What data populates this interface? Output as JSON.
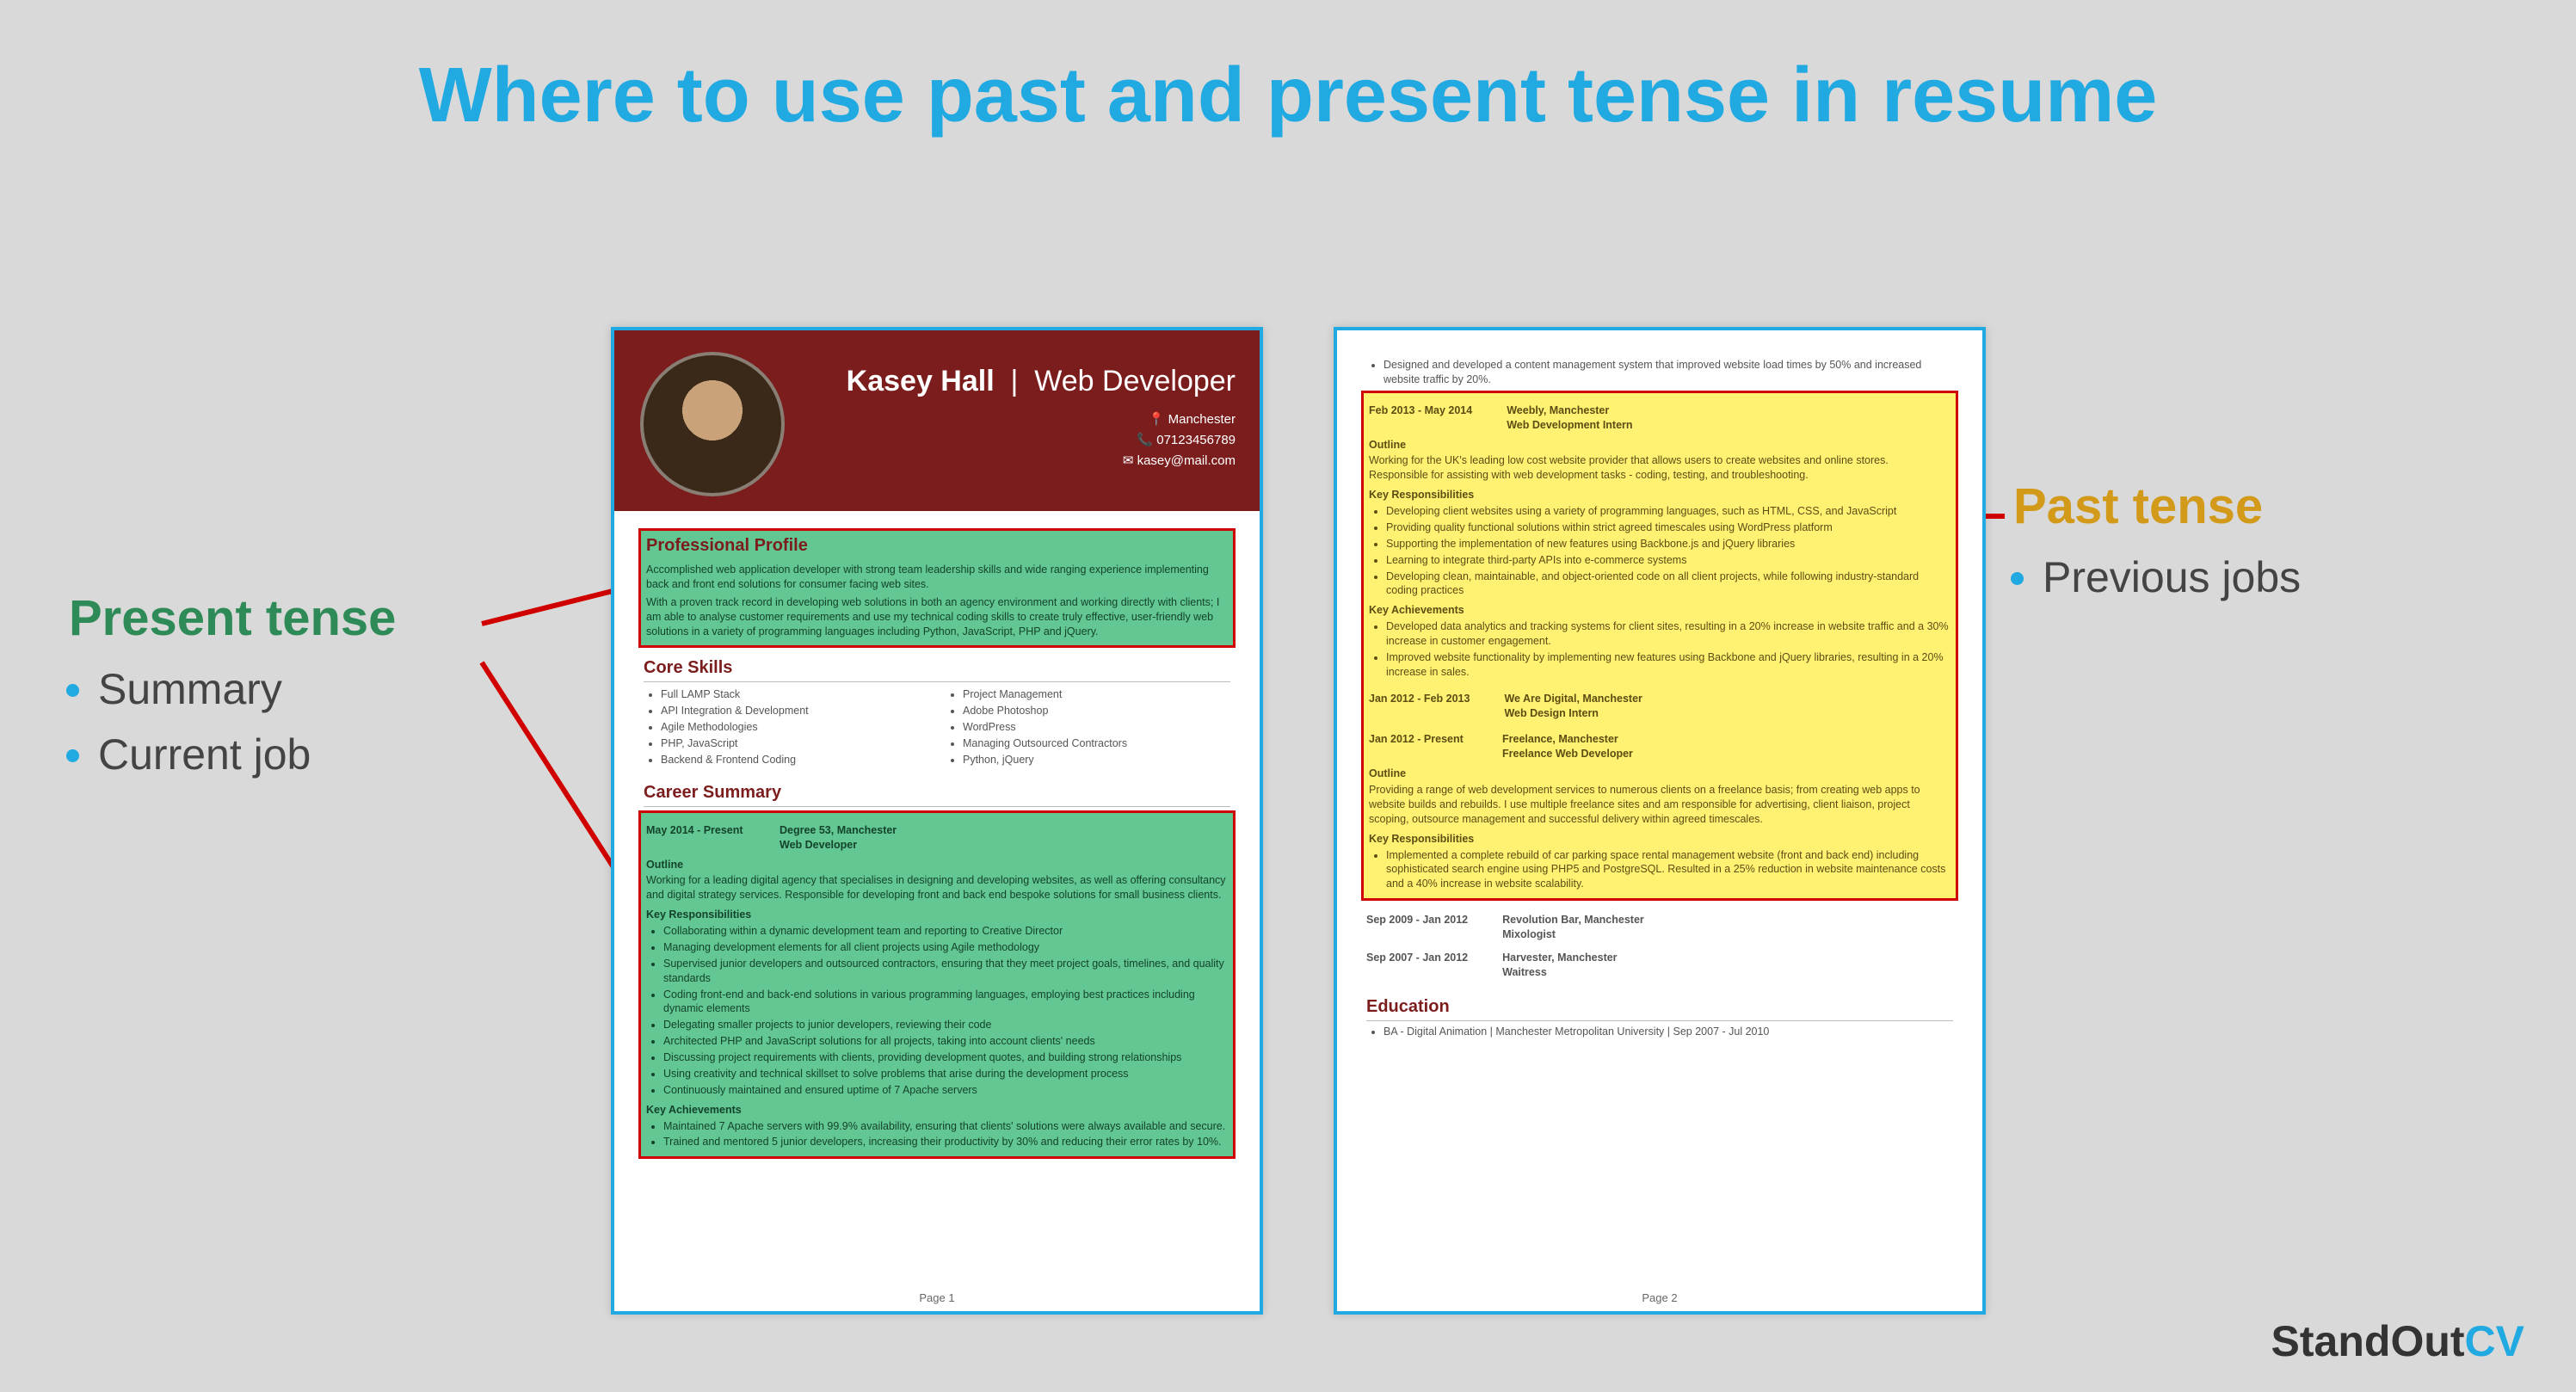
{
  "title": "Where to use past and present tense in resume",
  "annotations": {
    "present": {
      "heading": "Present tense",
      "items": [
        "Summary",
        "Current job"
      ]
    },
    "past": {
      "heading": "Past tense",
      "items": [
        "Previous jobs"
      ]
    }
  },
  "brand": {
    "name": "StandOut",
    "suffix": "CV"
  },
  "resume": {
    "name": "Kasey Hall",
    "role": "Web Developer",
    "contacts": {
      "location": "Manchester",
      "phone": "07123456789",
      "email": "kasey@mail.com"
    },
    "sections": {
      "profile_title": "Professional Profile",
      "profile_p1": "Accomplished web application developer with strong team leadership skills and wide ranging experience implementing back and front end solutions for consumer facing web sites.",
      "profile_p2": "With a proven track record in developing web solutions in both an agency environment and working directly with clients; I am able to analyse customer requirements and use my technical coding skills to create truly effective, user-friendly web solutions in a variety of programming languages including Python, JavaScript, PHP and jQuery.",
      "skills_title": "Core Skills",
      "skills_left": [
        "Full LAMP Stack",
        "API Integration & Development",
        "Agile Methodologies",
        "PHP, JavaScript",
        "Backend & Frontend Coding"
      ],
      "skills_right": [
        "Project Management",
        "Adobe Photoshop",
        "WordPress",
        "Managing Outsourced Contractors",
        "Python, jQuery"
      ],
      "career_title": "Career Summary",
      "job1": {
        "dates": "May 2014 - Present",
        "company": "Degree 53, Manchester",
        "title": "Web Developer",
        "outline_label": "Outline",
        "outline": "Working for a leading digital agency that specialises in designing and developing websites, as well as offering consultancy and digital strategy services. Responsible for developing front and back end bespoke solutions for small business clients.",
        "resp_label": "Key Responsibilities",
        "resp": [
          "Collaborating within a dynamic development team and reporting to Creative Director",
          "Managing development elements for all client projects using Agile methodology",
          "Supervised junior developers and outsourced contractors, ensuring that they meet project goals, timelines, and quality standards",
          "Coding front-end and back-end solutions in various programming languages, employing best practices including dynamic elements",
          "Delegating smaller projects to junior developers, reviewing their code",
          "Architected PHP and JavaScript solutions for all projects, taking into account clients' needs",
          "Discussing project requirements with clients, providing development quotes, and building strong relationships",
          "Using creativity and technical skillset to solve problems that arise during the development process",
          "Continuously maintained and ensured uptime of 7 Apache servers"
        ],
        "ach_label": "Key Achievements",
        "ach": [
          "Maintained 7 Apache servers with 99.9% availability, ensuring that clients' solutions were always available and secure.",
          "Trained and mentored 5 junior developers, increasing their productivity by 30% and reducing their error rates by 10%."
        ]
      },
      "page2_top_bullet": "Designed and developed a content management system that improved website load times by 50% and increased website traffic by 20%.",
      "job2": {
        "dates": "Feb 2013 - May 2014",
        "company": "Weebly, Manchester",
        "title": "Web Development Intern",
        "outline_label": "Outline",
        "outline": "Working for the UK's leading low cost website provider that allows users to create websites and online stores. Responsible for assisting with web development tasks - coding, testing, and troubleshooting.",
        "resp_label": "Key Responsibilities",
        "resp": [
          "Developing client websites using a variety of programming languages, such as HTML, CSS, and JavaScript",
          "Providing quality functional solutions within strict agreed timescales using WordPress platform",
          "Supporting the implementation of new features using Backbone.js and jQuery libraries",
          "Learning to integrate third-party APIs into e-commerce systems",
          "Developing clean, maintainable, and object-oriented code on all client projects, while following industry-standard coding practices"
        ],
        "ach_label": "Key Achievements",
        "ach": [
          "Developed data analytics and tracking systems for client sites, resulting in a 20% increase in website traffic and a 30% increase in customer engagement.",
          "Improved website functionality by implementing new features using Backbone and jQuery libraries, resulting in a 20% increase in sales."
        ]
      },
      "job3": {
        "dates": "Jan 2012 - Feb 2013",
        "company": "We Are Digital, Manchester",
        "title": "Web Design Intern"
      },
      "job4": {
        "dates": "Jan 2012 - Present",
        "company": "Freelance, Manchester",
        "title": "Freelance Web Developer",
        "outline_label": "Outline",
        "outline": "Providing a range of web development services to numerous clients on a freelance basis; from creating web apps to website builds and rebuilds. I use multiple freelance sites and am responsible for advertising, client liaison, project scoping, outsource management and successful delivery within agreed timescales.",
        "resp_label": "Key Responsibilities",
        "resp": [
          "Implemented a complete rebuild of car parking space rental management website (front and back end) including sophisticated search engine using PHP5 and PostgreSQL. Resulted in a 25% reduction in website maintenance costs and a 40% increase in website scalability."
        ]
      },
      "job5": {
        "dates": "Sep 2009 - Jan 2012",
        "company": "Revolution Bar, Manchester",
        "title": "Mixologist"
      },
      "job6": {
        "dates": "Sep 2007 - Jan 2012",
        "company": "Harvester, Manchester",
        "title": "Waitress"
      },
      "education_title": "Education",
      "education_item": "BA - Digital Animation | Manchester Metropolitan University | Sep 2007 - Jul 2010"
    },
    "page_labels": {
      "p1": "Page 1",
      "p2": "Page 2"
    }
  }
}
